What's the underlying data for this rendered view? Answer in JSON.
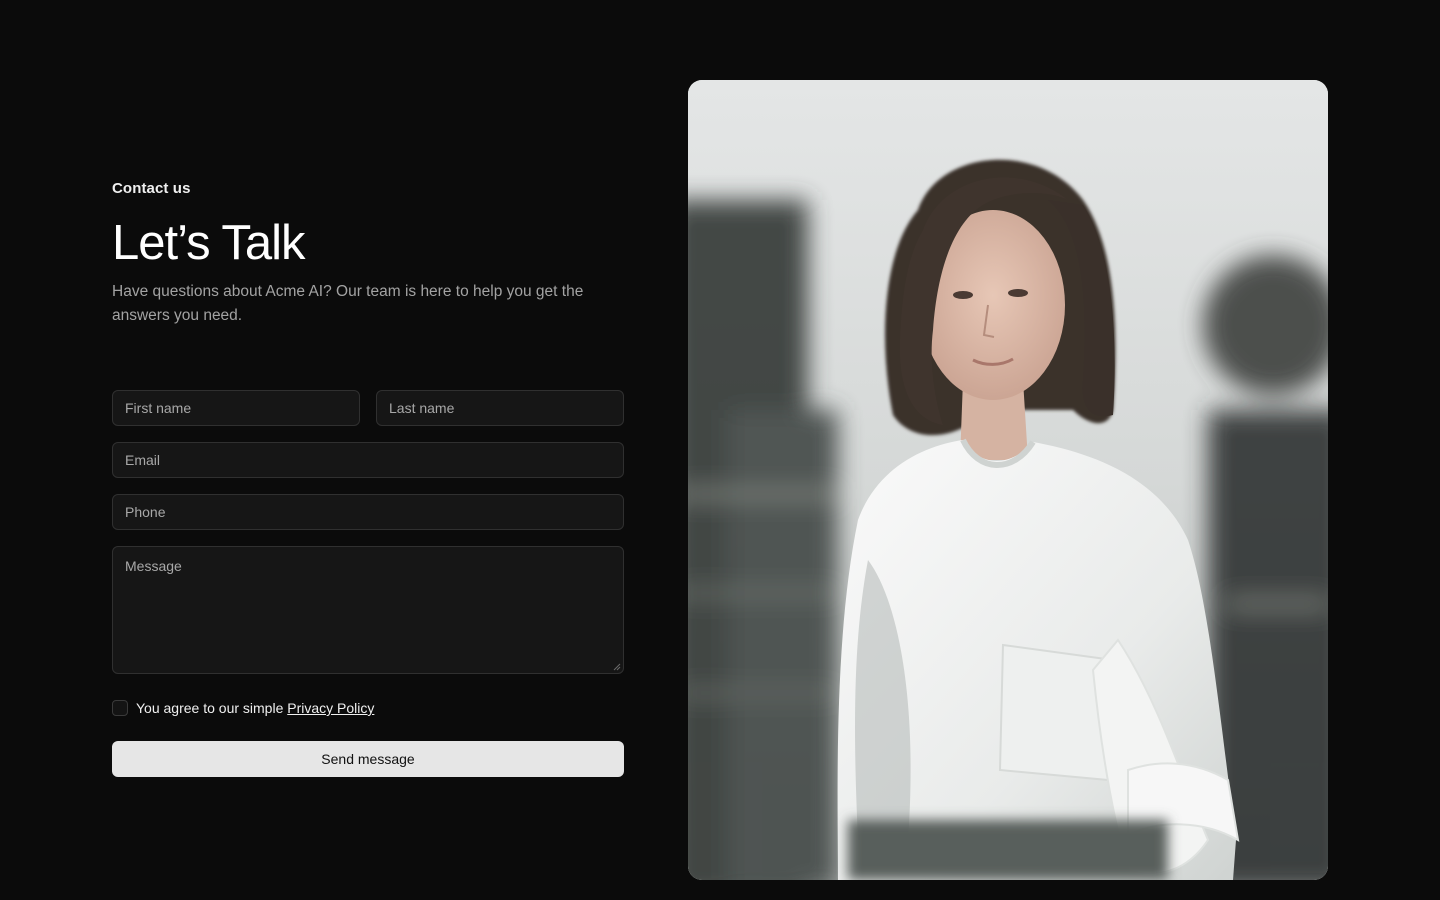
{
  "header": {
    "eyebrow": "Contact us",
    "title": "Let’s Talk",
    "subtitle": "Have questions about Acme AI? Our team is here to help you get the answers you need."
  },
  "form": {
    "first_name": {
      "placeholder": "First name",
      "value": ""
    },
    "last_name": {
      "placeholder": "Last name",
      "value": ""
    },
    "email": {
      "placeholder": "Email",
      "value": ""
    },
    "phone": {
      "placeholder": "Phone",
      "value": ""
    },
    "message": {
      "placeholder": "Message",
      "value": ""
    },
    "agree_text": "You agree to our simple",
    "policy_link": "Privacy Policy",
    "agree_checked": false,
    "submit_label": "Send message"
  },
  "image": {
    "icon": "portrait-photo",
    "subject": "woman in white shirt with motion-blurred people"
  },
  "colors": {
    "background": "#0b0b0b",
    "field_bg": "#161616",
    "field_border": "#303030",
    "button_bg": "#e6e6e6",
    "button_text": "#111111"
  }
}
